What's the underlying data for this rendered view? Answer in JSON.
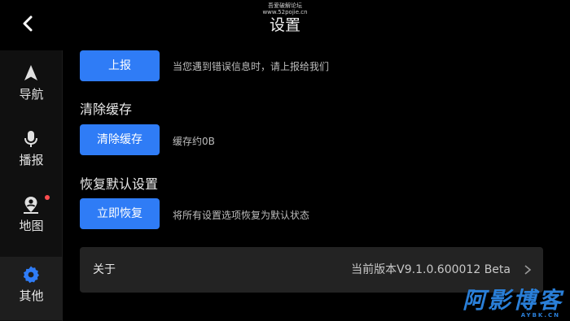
{
  "header": {
    "title": "设置",
    "watermark_line1": "吾爱破解论坛",
    "watermark_line2": "www.52pojie.cn",
    "back_icon": "back-arrow-icon"
  },
  "sidebar": {
    "items": [
      {
        "label": "导航",
        "icon": "navigation-arrow-icon",
        "active": false
      },
      {
        "label": "播报",
        "icon": "microphone-icon",
        "active": false
      },
      {
        "label": "地图",
        "icon": "map-pin-icon",
        "active": false,
        "badge": "red-dot"
      },
      {
        "label": "其他",
        "icon": "gear-icon",
        "active": true
      }
    ]
  },
  "sections": {
    "report": {
      "button": "上报",
      "hint": "当您遇到错误信息时，请上报给我们"
    },
    "cache": {
      "title": "清除缓存",
      "button": "清除缓存",
      "hint": "缓存约0B"
    },
    "reset": {
      "title": "恢复默认设置",
      "button": "立即恢复",
      "hint": "将所有设置选项恢复为默认状态"
    },
    "about": {
      "label": "关于",
      "version": "当前版本V9.1.0.600012 Beta"
    }
  },
  "brand": {
    "cn": "阿影博客",
    "en": "AYBK.CN"
  },
  "colors": {
    "accent": "#2f7cf6",
    "background": "#000000",
    "badge": "#ff4d4f",
    "brand": "#2a7fd8"
  }
}
